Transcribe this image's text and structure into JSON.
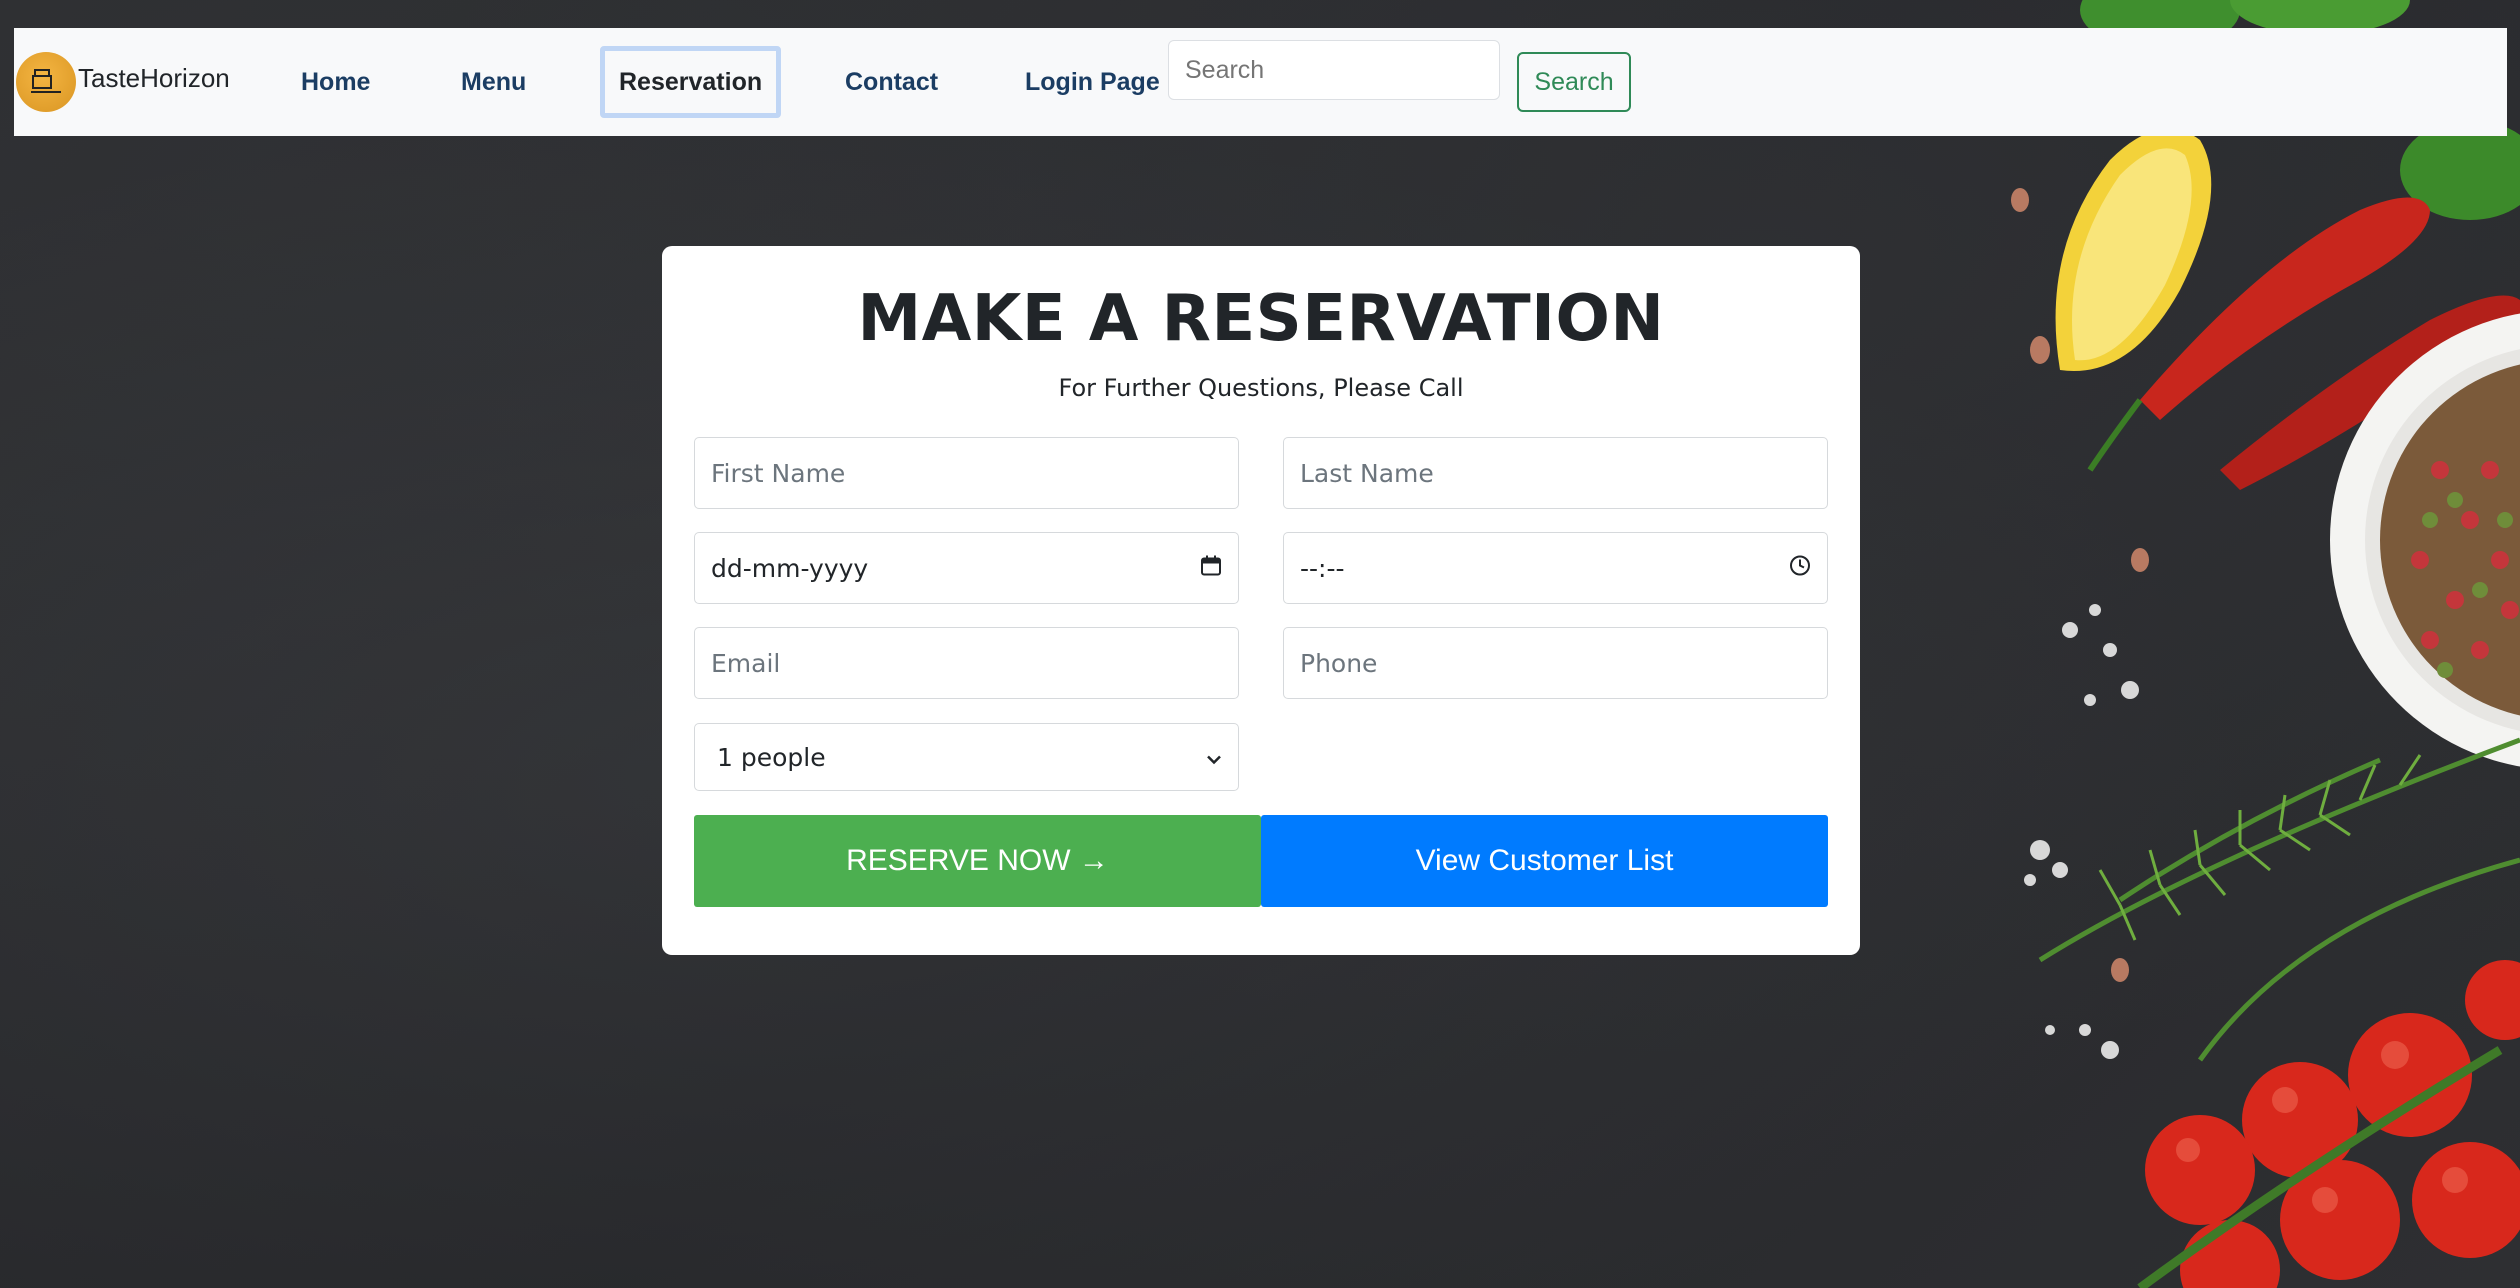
{
  "brand": {
    "name": "TasteHorizon",
    "logo_icon": "restaurant-logo-icon"
  },
  "nav": {
    "items": [
      {
        "label": "Home",
        "active": false
      },
      {
        "label": "Menu",
        "active": false
      },
      {
        "label": "Reservation",
        "active": true
      },
      {
        "label": "Contact",
        "active": false
      },
      {
        "label": "Login Page",
        "active": false
      }
    ],
    "search_placeholder": "Search",
    "search_button": "Search"
  },
  "form": {
    "title": "MAKE A RESERVATION",
    "subtitle": "For Further Questions, Please Call",
    "first_name_placeholder": "First Name",
    "last_name_placeholder": "Last Name",
    "date_placeholder": "dd-mm-yyyy",
    "time_placeholder": "--:--",
    "email_placeholder": "Email",
    "phone_placeholder": "Phone",
    "people_selected": "1 people",
    "reserve_button": "RESERVE NOW →",
    "view_button": "View Customer List"
  },
  "colors": {
    "reserve": "#4caf50",
    "view": "#007bff",
    "nav_link": "#1b3d63",
    "search_btn": "#2f8a57"
  }
}
